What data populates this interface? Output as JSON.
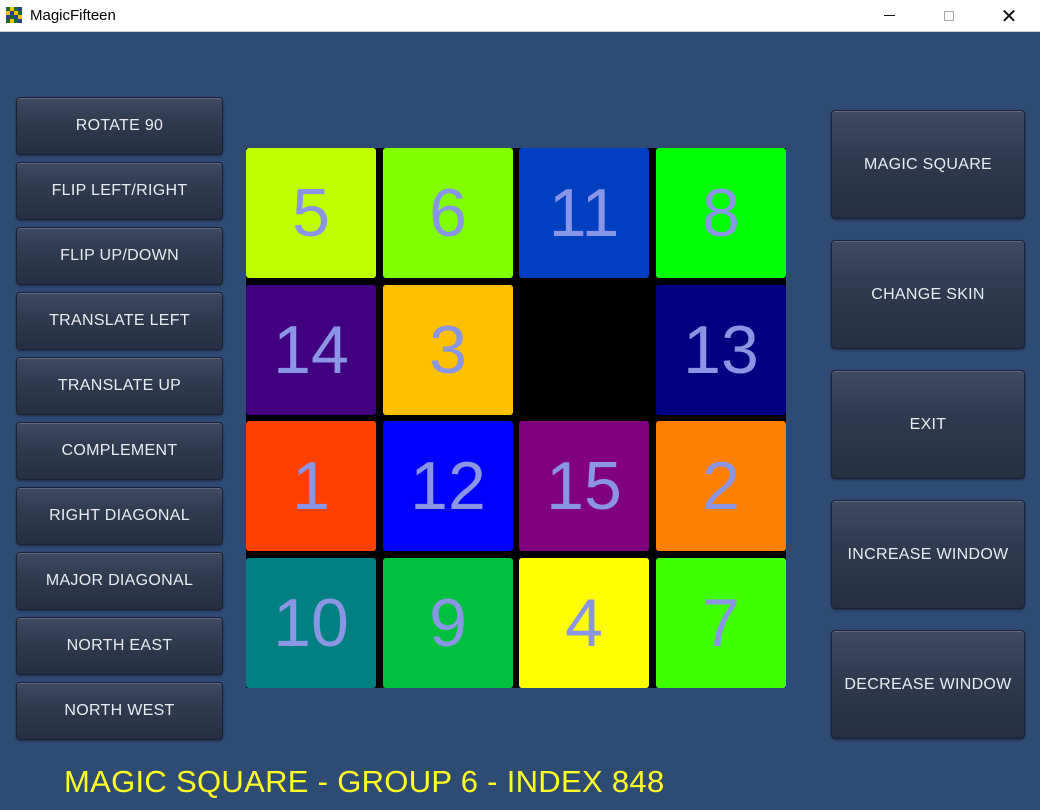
{
  "window": {
    "title": "MagicFifteen",
    "minimize_icon": "minimize-icon",
    "maximize_icon": "maximize-icon",
    "close_icon": "close-icon",
    "close_glyph": "✕"
  },
  "left_buttons": [
    {
      "label": "ROTATE 90"
    },
    {
      "label": "FLIP LEFT/RIGHT"
    },
    {
      "label": "FLIP UP/DOWN"
    },
    {
      "label": "TRANSLATE LEFT"
    },
    {
      "label": "TRANSLATE UP"
    },
    {
      "label": "COMPLEMENT"
    },
    {
      "label": "RIGHT DIAGONAL"
    },
    {
      "label": "MAJOR DIAGONAL"
    },
    {
      "label": "NORTH EAST"
    },
    {
      "label": "NORTH WEST"
    }
  ],
  "right_buttons": [
    {
      "label": "MAGIC SQUARE"
    },
    {
      "label": "CHANGE SKIN"
    },
    {
      "label": "EXIT"
    },
    {
      "label": "INCREASE WINDOW"
    },
    {
      "label": "DECREASE WINDOW"
    }
  ],
  "board": {
    "rows": 4,
    "cols": 4,
    "tiles": [
      {
        "value": "5",
        "color": "#bfff00"
      },
      {
        "value": "6",
        "color": "#80ff00"
      },
      {
        "value": "11",
        "color": "#0040c0"
      },
      {
        "value": "8",
        "color": "#00ff00"
      },
      {
        "value": "14",
        "color": "#400080"
      },
      {
        "value": "3",
        "color": "#ffc000"
      },
      {
        "value": "",
        "color": "#000000",
        "empty": true
      },
      {
        "value": "13",
        "color": "#000080"
      },
      {
        "value": "1",
        "color": "#ff4000"
      },
      {
        "value": "12",
        "color": "#0000ff"
      },
      {
        "value": "15",
        "color": "#800080"
      },
      {
        "value": "2",
        "color": "#ff8000"
      },
      {
        "value": "10",
        "color": "#008080"
      },
      {
        "value": "9",
        "color": "#00c040"
      },
      {
        "value": "4",
        "color": "#ffff00"
      },
      {
        "value": "7",
        "color": "#40ff00"
      }
    ],
    "number_color": "#8b95e6"
  },
  "status": {
    "text": "MAGIC SQUARE - GROUP 6 - INDEX 848",
    "color": "#ffff22"
  },
  "colors": {
    "background": "#2e4b74",
    "button_text": "#e8ecf2"
  }
}
